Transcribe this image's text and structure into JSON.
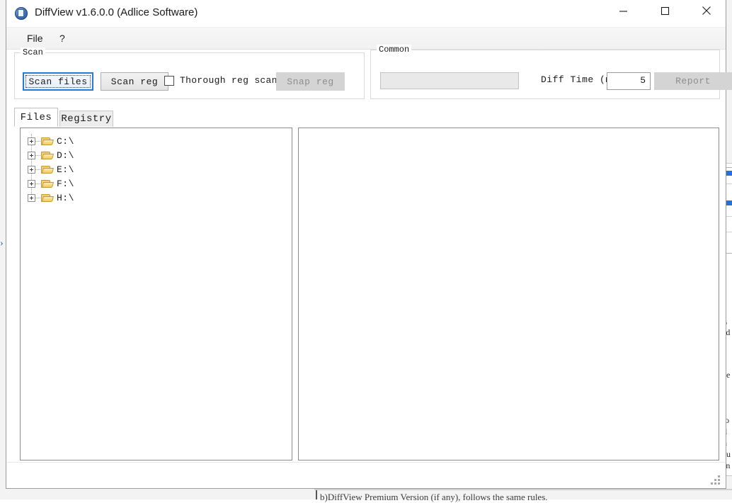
{
  "window": {
    "title": "DiffView v1.6.0.0 (Adlice Software)",
    "icon": "app-shield-icon",
    "controls": {
      "minimize": "minimize-icon",
      "maximize": "maximize-icon",
      "close": "close-icon"
    }
  },
  "menu": {
    "items": [
      {
        "label": "File"
      },
      {
        "label": "?"
      }
    ]
  },
  "scan_group": {
    "title": "Scan",
    "scan_files_label": "Scan files",
    "scan_reg_label": "Scan reg",
    "thorough_label": "Thorough reg scan",
    "thorough_checked": false,
    "snap_reg_label": "Snap reg",
    "snap_reg_enabled": false
  },
  "common_group": {
    "title": "Common",
    "status_value": "",
    "diff_time_label": "Diff Time (mn)",
    "diff_time_value": "5",
    "report_label": "Report",
    "report_enabled": false
  },
  "tabs": [
    {
      "label": "Files",
      "selected": true
    },
    {
      "label": "Registry",
      "selected": false
    }
  ],
  "tree": {
    "nodes": [
      {
        "label": "C:\\",
        "expander": "plus",
        "icon": "folder-icon"
      },
      {
        "label": "D:\\",
        "expander": "plus",
        "icon": "folder-icon"
      },
      {
        "label": "E:\\",
        "expander": "plus",
        "icon": "folder-icon"
      },
      {
        "label": "F:\\",
        "expander": "plus",
        "icon": "folder-icon"
      },
      {
        "label": "H:\\",
        "expander": "plus",
        "icon": "folder-icon"
      }
    ]
  },
  "detail_panel": {
    "content": ""
  },
  "status_bar": {
    "resize_grip": "resize-grip-icon"
  },
  "background": {
    "bottom_text": "b)DiffView Premium Version (if any), follows the same rules.",
    "side_fragments": [
      "o",
      "ed",
      "he",
      "ro",
      "d",
      "n",
      "ou",
      "an"
    ]
  },
  "colors": {
    "accent": "#2a7ad4",
    "window_bg": "#ffffff",
    "toolbar_bg": "#f1f1f1",
    "button_face": "#e4e4e4",
    "disabled_text": "#8e8e8e",
    "folder": "#f2cf74"
  }
}
